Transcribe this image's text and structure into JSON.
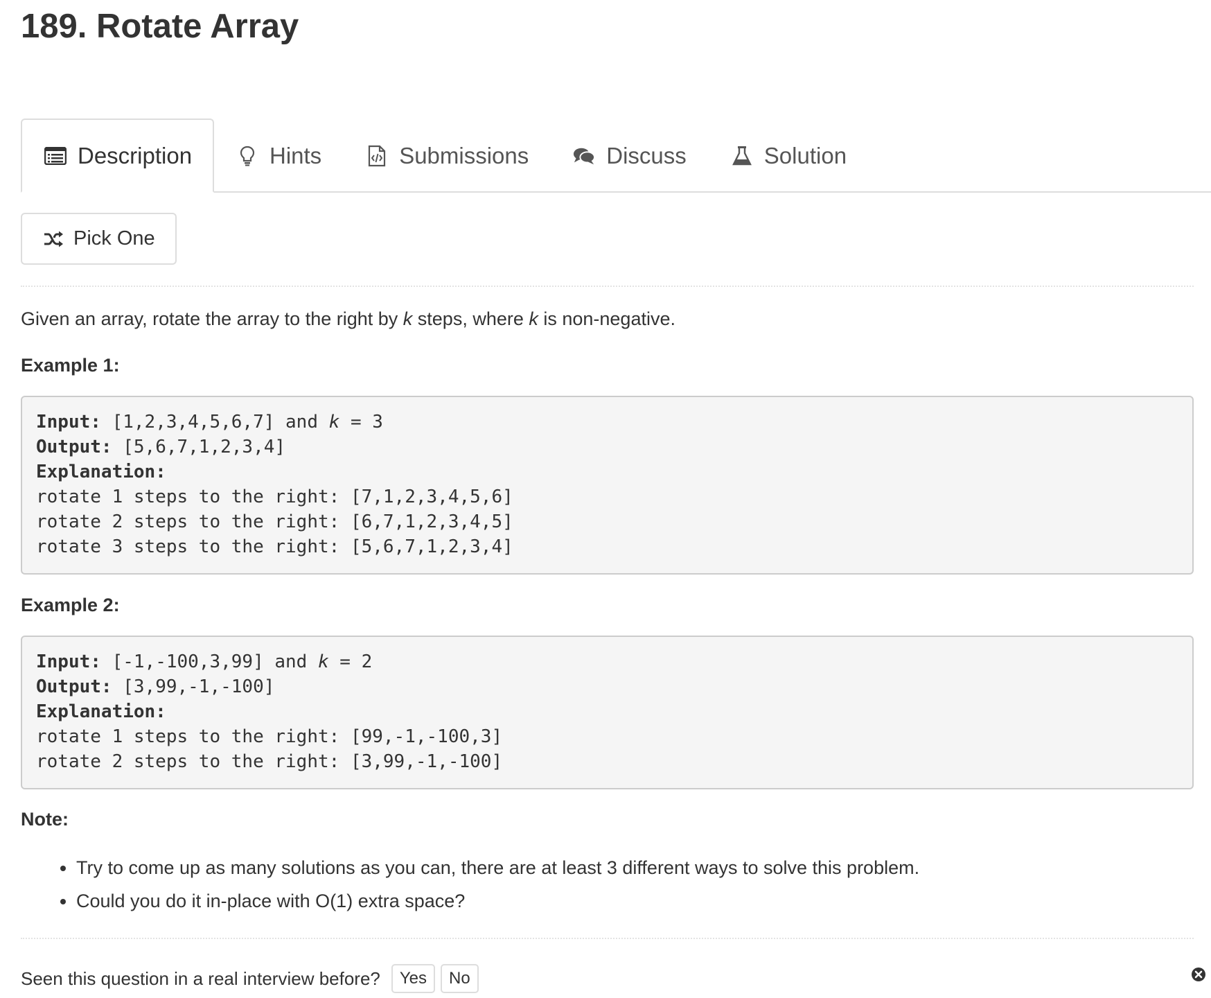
{
  "problem": {
    "title": "189. Rotate Array"
  },
  "tabs": [
    {
      "label": "Description",
      "icon": "list-icon",
      "active": true
    },
    {
      "label": "Hints",
      "icon": "lightbulb-icon",
      "active": false
    },
    {
      "label": "Submissions",
      "icon": "code-file-icon",
      "active": false
    },
    {
      "label": "Discuss",
      "icon": "comments-icon",
      "active": false
    },
    {
      "label": "Solution",
      "icon": "flask-icon",
      "active": false
    }
  ],
  "pick_one": {
    "label": "Pick One",
    "icon": "shuffle-icon"
  },
  "description": {
    "part1": "Given an array, rotate the array to the right by ",
    "k1": "k",
    "part2": " steps, where ",
    "k2": "k",
    "part3": " is non-negative."
  },
  "examples": [
    {
      "heading": "Example 1:",
      "input_label": "Input:",
      "input_value": " [1,2,3,4,5,6,7] and ",
      "input_k": "k",
      "input_k_value": " = 3",
      "output_label": "Output:",
      "output_value": " [5,6,7,1,2,3,4]",
      "explanation_label": "Explanation:",
      "steps": [
        "rotate 1 steps to the right: [7,1,2,3,4,5,6]",
        "rotate 2 steps to the right: [6,7,1,2,3,4,5]",
        "rotate 3 steps to the right: [5,6,7,1,2,3,4]"
      ]
    },
    {
      "heading": "Example 2:",
      "input_label": "Input:",
      "input_value": " [-1,-100,3,99] and ",
      "input_k": "k",
      "input_k_value": " = 2",
      "output_label": "Output:",
      "output_value": " [3,99,-1,-100]",
      "explanation_label": "Explanation:",
      "steps": [
        "rotate 1 steps to the right: [99,-1,-100,3]",
        "rotate 2 steps to the right: [3,99,-1,-100]"
      ]
    }
  ],
  "note": {
    "heading": "Note:",
    "items": [
      "Try to come up as many solutions as you can, there are at least 3 different ways to solve this problem.",
      "Could you do it in-place with O(1) extra space?"
    ]
  },
  "interview": {
    "question": "Seen this question in a real interview before?",
    "yes_label": "Yes",
    "no_label": "No",
    "close_icon": "close-circle-icon"
  }
}
